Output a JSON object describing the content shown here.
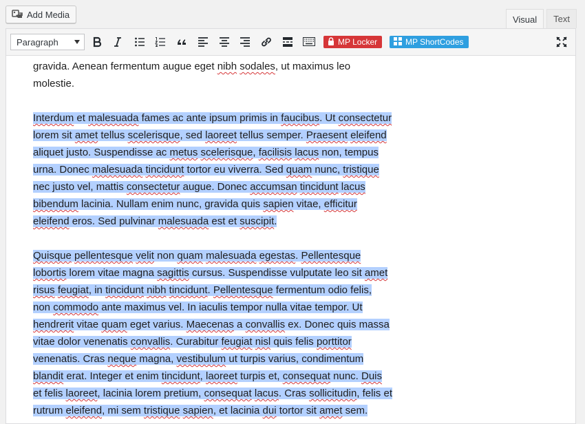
{
  "add_media": {
    "label": "Add Media"
  },
  "tabs": [
    {
      "label": "Visual",
      "active": true
    },
    {
      "label": "Text",
      "active": false
    }
  ],
  "toolbar": {
    "format_value": "Paragraph",
    "buttons": [
      "bold-icon",
      "italic-icon",
      "bullet-list-icon",
      "numbered-list-icon",
      "blockquote-icon",
      "align-left-icon",
      "align-center-icon",
      "align-right-icon",
      "link-icon",
      "read-more-icon",
      "toolbar-toggle-icon"
    ],
    "mp_locker_label": "MP Locker",
    "mp_shortcodes_label": "MP ShortCodes",
    "colors": {
      "locker": "#d63638",
      "shortcodes": "#2f9fe0",
      "selection": "#b3d0ff",
      "spellcheck": "#d63638"
    }
  },
  "content": {
    "paragraphs": [
      {
        "selected": false,
        "lines": [
          [
            [
              "gravida. Aenean fermentum augue eget ",
              0
            ],
            [
              "nibh",
              1
            ],
            [
              " ",
              0
            ],
            [
              "sodales",
              1
            ],
            [
              ", ut maximus leo",
              0
            ]
          ],
          [
            [
              "molestie.",
              0
            ]
          ]
        ]
      },
      {
        "selected": true,
        "lines": [
          [
            [
              "Interdum",
              1
            ],
            [
              " et ",
              0
            ],
            [
              "malesuada",
              1
            ],
            [
              " fames ac ante ipsum primis in ",
              0
            ],
            [
              "faucibus",
              1
            ],
            [
              ". Ut ",
              0
            ],
            [
              "consectetur",
              1
            ]
          ],
          [
            [
              "lorem sit ",
              0
            ],
            [
              "amet",
              1
            ],
            [
              " tellus ",
              0
            ],
            [
              "scelerisque",
              1
            ],
            [
              ", sed ",
              0
            ],
            [
              "laoreet",
              1
            ],
            [
              " tellus semper. ",
              0
            ],
            [
              "Praesent",
              1
            ],
            [
              " ",
              0
            ],
            [
              "eleifend",
              1
            ]
          ],
          [
            [
              "aliquet justo. Suspendisse ac ",
              0
            ],
            [
              "metus",
              1
            ],
            [
              " ",
              0
            ],
            [
              "scelerisque",
              1
            ],
            [
              ", ",
              0
            ],
            [
              "facilisis",
              1
            ],
            [
              " ",
              0
            ],
            [
              "lacus",
              1
            ],
            [
              " non, tempus",
              0
            ]
          ],
          [
            [
              "urna. Donec ",
              0
            ],
            [
              "malesuada",
              1
            ],
            [
              " ",
              0
            ],
            [
              "tincidunt",
              1
            ],
            [
              " tortor eu viverra. Sed ",
              0
            ],
            [
              "quam",
              1
            ],
            [
              " nunc, ",
              0
            ],
            [
              "tristique",
              1
            ]
          ],
          [
            [
              "nec justo vel, mattis ",
              0
            ],
            [
              "consectetur",
              1
            ],
            [
              " augue. Donec ",
              0
            ],
            [
              "accumsan",
              1
            ],
            [
              " ",
              0
            ],
            [
              "tincidunt",
              1
            ],
            [
              " ",
              0
            ],
            [
              "lacus",
              1
            ]
          ],
          [
            [
              "bibendum",
              1
            ],
            [
              " lacinia. Nullam enim nunc, gravida quis ",
              0
            ],
            [
              "sapien",
              1
            ],
            [
              " vitae, ",
              0
            ],
            [
              "efficitur",
              1
            ]
          ],
          [
            [
              "eleifend",
              1
            ],
            [
              " eros. Sed pulvinar ",
              0
            ],
            [
              "malesuada",
              1
            ],
            [
              " est et ",
              0
            ],
            [
              "suscipit",
              1
            ],
            [
              ".",
              0
            ]
          ]
        ]
      },
      {
        "selected": true,
        "lines": [
          [
            [
              "Quisque",
              1
            ],
            [
              " ",
              0
            ],
            [
              "pellentesque",
              1
            ],
            [
              " ",
              0
            ],
            [
              "velit",
              1
            ],
            [
              " non ",
              0
            ],
            [
              "quam",
              1
            ],
            [
              " ",
              0
            ],
            [
              "malesuada",
              1
            ],
            [
              " ",
              0
            ],
            [
              "egestas",
              1
            ],
            [
              ". ",
              0
            ],
            [
              "Pellentesque",
              1
            ]
          ],
          [
            [
              "lobortis",
              1
            ],
            [
              " lorem vitae magna ",
              0
            ],
            [
              "sagittis",
              1
            ],
            [
              " cursus. Suspendisse vulputate leo sit ",
              0
            ],
            [
              "amet",
              1
            ]
          ],
          [
            [
              "risus",
              1
            ],
            [
              " ",
              0
            ],
            [
              "feugiat",
              1
            ],
            [
              ", in ",
              0
            ],
            [
              "tincidunt",
              1
            ],
            [
              " ",
              0
            ],
            [
              "nibh",
              1
            ],
            [
              " ",
              0
            ],
            [
              "tincidunt",
              1
            ],
            [
              ". ",
              0
            ],
            [
              "Pellentesque",
              1
            ],
            [
              " fermentum odio felis,",
              0
            ]
          ],
          [
            [
              "non ",
              0
            ],
            [
              "commodo",
              1
            ],
            [
              " ante maximus vel. In iaculis tempor nulla vitae tempor. Ut",
              0
            ]
          ],
          [
            [
              "hendrerit",
              1
            ],
            [
              " vitae ",
              0
            ],
            [
              "quam",
              1
            ],
            [
              " eget varius. ",
              0
            ],
            [
              "Maecenas",
              1
            ],
            [
              " a ",
              0
            ],
            [
              "convallis",
              1
            ],
            [
              " ex. Donec quis massa",
              0
            ]
          ],
          [
            [
              "vitae dolor venenatis ",
              0
            ],
            [
              "convallis",
              1
            ],
            [
              ". Curabitur ",
              0
            ],
            [
              "feugiat",
              1
            ],
            [
              " ",
              0
            ],
            [
              "nisl",
              1
            ],
            [
              " quis felis ",
              0
            ],
            [
              "porttitor",
              1
            ]
          ],
          [
            [
              "venenatis. Cras ",
              0
            ],
            [
              "neque",
              1
            ],
            [
              " magna, ",
              0
            ],
            [
              "vestibulum",
              1
            ],
            [
              " ut turpis varius, condimentum",
              0
            ]
          ],
          [
            [
              "blandit",
              1
            ],
            [
              " erat. Integer et enim ",
              0
            ],
            [
              "tincidunt",
              1
            ],
            [
              ", ",
              0
            ],
            [
              "laoreet",
              1
            ],
            [
              " turpis et, ",
              0
            ],
            [
              "consequat",
              1
            ],
            [
              " nunc. ",
              0
            ],
            [
              "Duis",
              1
            ]
          ],
          [
            [
              "et felis ",
              0
            ],
            [
              "laoreet",
              1
            ],
            [
              ", lacinia lorem pretium, ",
              0
            ],
            [
              "consequat",
              1
            ],
            [
              " ",
              0
            ],
            [
              "lacus",
              1
            ],
            [
              ". Cras ",
              0
            ],
            [
              "sollicitudin",
              1
            ],
            [
              ", felis et",
              0
            ]
          ],
          [
            [
              "rutrum ",
              0
            ],
            [
              "eleifend",
              1
            ],
            [
              ", mi sem ",
              0
            ],
            [
              "tristique",
              1
            ],
            [
              " ",
              0
            ],
            [
              "sapien",
              1
            ],
            [
              ", et lacinia ",
              0
            ],
            [
              "dui",
              1
            ],
            [
              " tortor sit ",
              0
            ],
            [
              "amet",
              1
            ],
            [
              " sem.",
              0
            ]
          ]
        ]
      }
    ]
  }
}
